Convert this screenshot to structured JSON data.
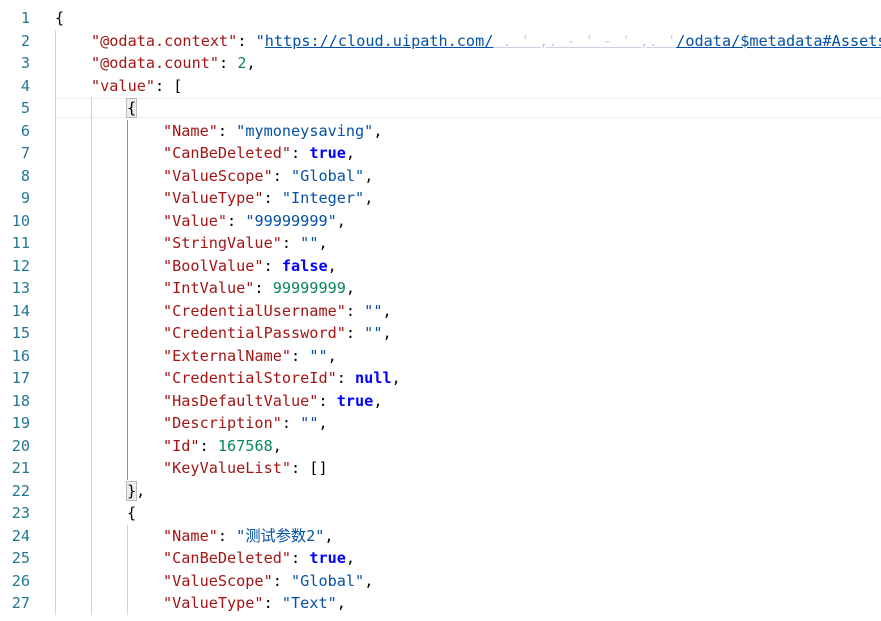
{
  "editor": {
    "language": "json",
    "colors": {
      "key": "#a31515",
      "string": "#0451a5",
      "number": "#098658",
      "keyword": "#0000ff",
      "punct": "#000000",
      "line_number": "#237893"
    },
    "lines": [
      {
        "n": "1",
        "indent": 0,
        "tokens": [
          {
            "t": "{",
            "c": "punct"
          }
        ]
      },
      {
        "n": "2",
        "indent": 1,
        "tokens": [
          {
            "t": "\"@odata.context\"",
            "c": "key"
          },
          {
            "t": ": ",
            "c": "punct"
          },
          {
            "t": "\"",
            "c": "string"
          },
          {
            "t": "https://cloud.uipath.com/",
            "c": "string",
            "link": true
          },
          {
            "t": " . ' ,. - ' - ' ,. '",
            "c": "string",
            "link": true,
            "faded": true
          },
          {
            "t": "/odata/$metadata#Assets",
            "c": "string",
            "link": true
          },
          {
            "t": "\"",
            "c": "string"
          },
          {
            "t": ",",
            "c": "punct"
          }
        ]
      },
      {
        "n": "3",
        "indent": 1,
        "tokens": [
          {
            "t": "\"@odata.count\"",
            "c": "key"
          },
          {
            "t": ": ",
            "c": "punct"
          },
          {
            "t": "2",
            "c": "number"
          },
          {
            "t": ",",
            "c": "punct"
          }
        ]
      },
      {
        "n": "4",
        "indent": 1,
        "tokens": [
          {
            "t": "\"value\"",
            "c": "key"
          },
          {
            "t": ": [",
            "c": "punct"
          }
        ]
      },
      {
        "n": "5",
        "indent": 2,
        "current": true,
        "tokens": [
          {
            "t": "{",
            "c": "punct",
            "match": true
          }
        ]
      },
      {
        "n": "6",
        "indent": 3,
        "tokens": [
          {
            "t": "\"Name\"",
            "c": "key"
          },
          {
            "t": ": ",
            "c": "punct"
          },
          {
            "t": "\"mymoneysaving\"",
            "c": "string"
          },
          {
            "t": ",",
            "c": "punct"
          }
        ]
      },
      {
        "n": "7",
        "indent": 3,
        "tokens": [
          {
            "t": "\"CanBeDeleted\"",
            "c": "key"
          },
          {
            "t": ": ",
            "c": "punct"
          },
          {
            "t": "true",
            "c": "keyword"
          },
          {
            "t": ",",
            "c": "punct"
          }
        ]
      },
      {
        "n": "8",
        "indent": 3,
        "tokens": [
          {
            "t": "\"ValueScope\"",
            "c": "key"
          },
          {
            "t": ": ",
            "c": "punct"
          },
          {
            "t": "\"Global\"",
            "c": "string"
          },
          {
            "t": ",",
            "c": "punct"
          }
        ]
      },
      {
        "n": "9",
        "indent": 3,
        "tokens": [
          {
            "t": "\"ValueType\"",
            "c": "key"
          },
          {
            "t": ": ",
            "c": "punct"
          },
          {
            "t": "\"Integer\"",
            "c": "string"
          },
          {
            "t": ",",
            "c": "punct"
          }
        ]
      },
      {
        "n": "10",
        "indent": 3,
        "tokens": [
          {
            "t": "\"Value\"",
            "c": "key"
          },
          {
            "t": ": ",
            "c": "punct"
          },
          {
            "t": "\"99999999\"",
            "c": "string"
          },
          {
            "t": ",",
            "c": "punct"
          }
        ]
      },
      {
        "n": "11",
        "indent": 3,
        "tokens": [
          {
            "t": "\"StringValue\"",
            "c": "key"
          },
          {
            "t": ": ",
            "c": "punct"
          },
          {
            "t": "\"\"",
            "c": "string"
          },
          {
            "t": ",",
            "c": "punct"
          }
        ]
      },
      {
        "n": "12",
        "indent": 3,
        "tokens": [
          {
            "t": "\"BoolValue\"",
            "c": "key"
          },
          {
            "t": ": ",
            "c": "punct"
          },
          {
            "t": "false",
            "c": "keyword"
          },
          {
            "t": ",",
            "c": "punct"
          }
        ]
      },
      {
        "n": "13",
        "indent": 3,
        "tokens": [
          {
            "t": "\"IntValue\"",
            "c": "key"
          },
          {
            "t": ": ",
            "c": "punct"
          },
          {
            "t": "99999999",
            "c": "number"
          },
          {
            "t": ",",
            "c": "punct"
          }
        ]
      },
      {
        "n": "14",
        "indent": 3,
        "tokens": [
          {
            "t": "\"CredentialUsername\"",
            "c": "key"
          },
          {
            "t": ": ",
            "c": "punct"
          },
          {
            "t": "\"\"",
            "c": "string"
          },
          {
            "t": ",",
            "c": "punct"
          }
        ]
      },
      {
        "n": "15",
        "indent": 3,
        "tokens": [
          {
            "t": "\"CredentialPassword\"",
            "c": "key"
          },
          {
            "t": ": ",
            "c": "punct"
          },
          {
            "t": "\"\"",
            "c": "string"
          },
          {
            "t": ",",
            "c": "punct"
          }
        ]
      },
      {
        "n": "16",
        "indent": 3,
        "tokens": [
          {
            "t": "\"ExternalName\"",
            "c": "key"
          },
          {
            "t": ": ",
            "c": "punct"
          },
          {
            "t": "\"\"",
            "c": "string"
          },
          {
            "t": ",",
            "c": "punct"
          }
        ]
      },
      {
        "n": "17",
        "indent": 3,
        "tokens": [
          {
            "t": "\"CredentialStoreId\"",
            "c": "key"
          },
          {
            "t": ": ",
            "c": "punct"
          },
          {
            "t": "null",
            "c": "keyword"
          },
          {
            "t": ",",
            "c": "punct"
          }
        ]
      },
      {
        "n": "18",
        "indent": 3,
        "tokens": [
          {
            "t": "\"HasDefaultValue\"",
            "c": "key"
          },
          {
            "t": ": ",
            "c": "punct"
          },
          {
            "t": "true",
            "c": "keyword"
          },
          {
            "t": ",",
            "c": "punct"
          }
        ]
      },
      {
        "n": "19",
        "indent": 3,
        "tokens": [
          {
            "t": "\"Description\"",
            "c": "key"
          },
          {
            "t": ": ",
            "c": "punct"
          },
          {
            "t": "\"\"",
            "c": "string"
          },
          {
            "t": ",",
            "c": "punct"
          }
        ]
      },
      {
        "n": "20",
        "indent": 3,
        "tokens": [
          {
            "t": "\"Id\"",
            "c": "key"
          },
          {
            "t": ": ",
            "c": "punct"
          },
          {
            "t": "167568",
            "c": "number"
          },
          {
            "t": ",",
            "c": "punct"
          }
        ]
      },
      {
        "n": "21",
        "indent": 3,
        "tokens": [
          {
            "t": "\"KeyValueList\"",
            "c": "key"
          },
          {
            "t": ": []",
            "c": "punct"
          }
        ]
      },
      {
        "n": "22",
        "indent": 2,
        "tokens": [
          {
            "t": "}",
            "c": "punct",
            "match": true
          },
          {
            "t": ",",
            "c": "punct"
          }
        ]
      },
      {
        "n": "23",
        "indent": 2,
        "tokens": [
          {
            "t": "{",
            "c": "punct"
          }
        ]
      },
      {
        "n": "24",
        "indent": 3,
        "tokens": [
          {
            "t": "\"Name\"",
            "c": "key"
          },
          {
            "t": ": ",
            "c": "punct"
          },
          {
            "t": "\"测试参数2\"",
            "c": "string"
          },
          {
            "t": ",",
            "c": "punct"
          }
        ]
      },
      {
        "n": "25",
        "indent": 3,
        "tokens": [
          {
            "t": "\"CanBeDeleted\"",
            "c": "key"
          },
          {
            "t": ": ",
            "c": "punct"
          },
          {
            "t": "true",
            "c": "keyword"
          },
          {
            "t": ",",
            "c": "punct"
          }
        ]
      },
      {
        "n": "26",
        "indent": 3,
        "tokens": [
          {
            "t": "\"ValueScope\"",
            "c": "key"
          },
          {
            "t": ": ",
            "c": "punct"
          },
          {
            "t": "\"Global\"",
            "c": "string"
          },
          {
            "t": ",",
            "c": "punct"
          }
        ]
      },
      {
        "n": "27",
        "indent": 3,
        "tokens": [
          {
            "t": "\"ValueType\"",
            "c": "key"
          },
          {
            "t": ": ",
            "c": "punct"
          },
          {
            "t": "\"Text\"",
            "c": "string"
          },
          {
            "t": ",",
            "c": "punct"
          }
        ]
      }
    ]
  }
}
